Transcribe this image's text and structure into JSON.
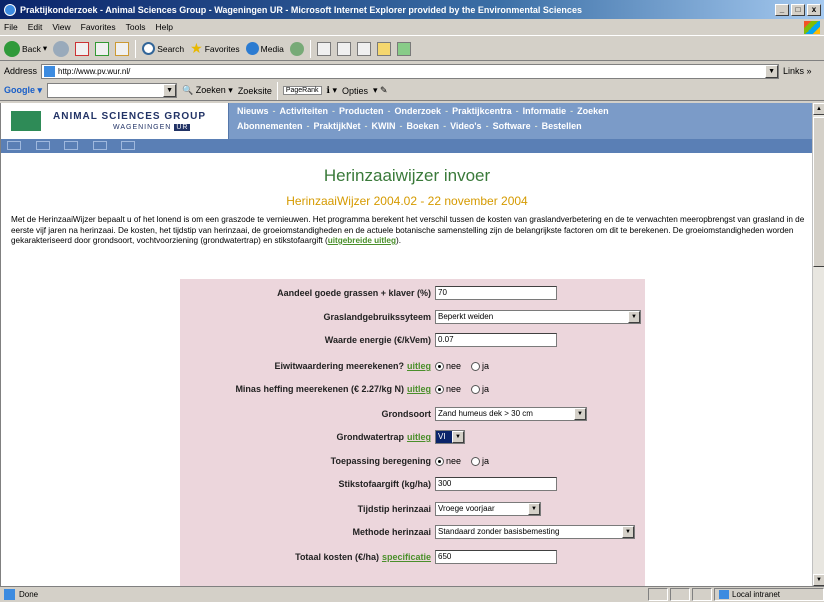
{
  "window": {
    "title": "Praktijkonderzoek - Animal Sciences Group - Wageningen UR - Microsoft Internet Explorer provided by the Environmental Sciences",
    "buttons": [
      "_",
      "□",
      "x"
    ]
  },
  "menu": [
    "File",
    "Edit",
    "View",
    "Favorites",
    "Tools",
    "Help"
  ],
  "toolbar": {
    "back": "Back",
    "search": "Search",
    "favorites": "Favorites",
    "media": "Media"
  },
  "address": {
    "label": "Address",
    "url": "http://www.pv.wur.nl/",
    "links": "Links"
  },
  "google": {
    "label": "Google",
    "zoeken": "Zoeken",
    "zoeksite": "Zoeksite",
    "pagerank": "PageRank",
    "opties": "Opties"
  },
  "site": {
    "logo_line1": "ANIMAL SCIENCES GROUP",
    "logo_line2": "WAGENINGEN",
    "logo_badge": "UR",
    "nav1": [
      "Nieuws",
      "Activiteiten",
      "Producten",
      "Onderzoek",
      "Praktijkcentra",
      "Informatie",
      "Zoeken"
    ],
    "nav2": [
      "Abonnementen",
      "PraktijkNet",
      "KWIN",
      "Boeken",
      "Video's",
      "Software",
      "Bestellen"
    ],
    "nav_sep": "-"
  },
  "page": {
    "title": "Herinzaaiwijzer invoer",
    "subtitle": "HerinzaaiWijzer 2004.02 - 22 november 2004",
    "intro": "Met de HerinzaaiWijzer bepaalt u of het lonend is om een graszode te vernieuwen. Het programma berekent het verschil tussen de kosten van graslandverbetering en de te verwachten meeropbrengst van grasland in de eerste vijf jaren na herinzaai. De kosten, het tijdstip van herinzaai, de groeiomstandigheden en de actuele botanische samenstelling zijn de belangrijkste factoren om dit te berekenen. De groeiomstandigheden worden gekarakteriseerd door grondsoort, vochtvoorziening (grondwatertrap) en stikstofaargift (",
    "intro_link": "uitgebreide uitleg",
    "intro_end": ")."
  },
  "form": {
    "aandeel": {
      "label": "Aandeel goede grassen + klaver (%)",
      "value": "70"
    },
    "gebruik": {
      "label": "Graslandgebruikssyteem",
      "value": "Beperkt weiden"
    },
    "energie": {
      "label": "Waarde energie (€/kVem)",
      "value": "0.07"
    },
    "eiwit": {
      "label": "Eiwitwaardering meerekenen?",
      "link": "uitleg",
      "opt1": "nee",
      "opt2": "ja"
    },
    "minas": {
      "label": "Minas heffing meerekenen (€ 2.27/kg N)",
      "link": "uitleg",
      "opt1": "nee",
      "opt2": "ja"
    },
    "grondsoort": {
      "label": "Grondsoort",
      "value": "Zand humeus dek > 30 cm"
    },
    "grondwater": {
      "label": "Grondwatertrap",
      "link": "uitleg",
      "value": "VI"
    },
    "beregening": {
      "label": "Toepassing beregening",
      "opt1": "nee",
      "opt2": "ja"
    },
    "stikstof": {
      "label": "Stikstofaargift (kg/ha)",
      "value": "300"
    },
    "tijdstip": {
      "label": "Tijdstip herinzaai",
      "value": "Vroege voorjaar"
    },
    "methode": {
      "label": "Methode herinzaai",
      "value": "Standaard zonder basisbemesting"
    },
    "kosten": {
      "label": "Totaal kosten (€/ha)",
      "link": "specificatie",
      "value": "650"
    }
  },
  "status": {
    "text": "Done",
    "zone": "Local intranet"
  }
}
